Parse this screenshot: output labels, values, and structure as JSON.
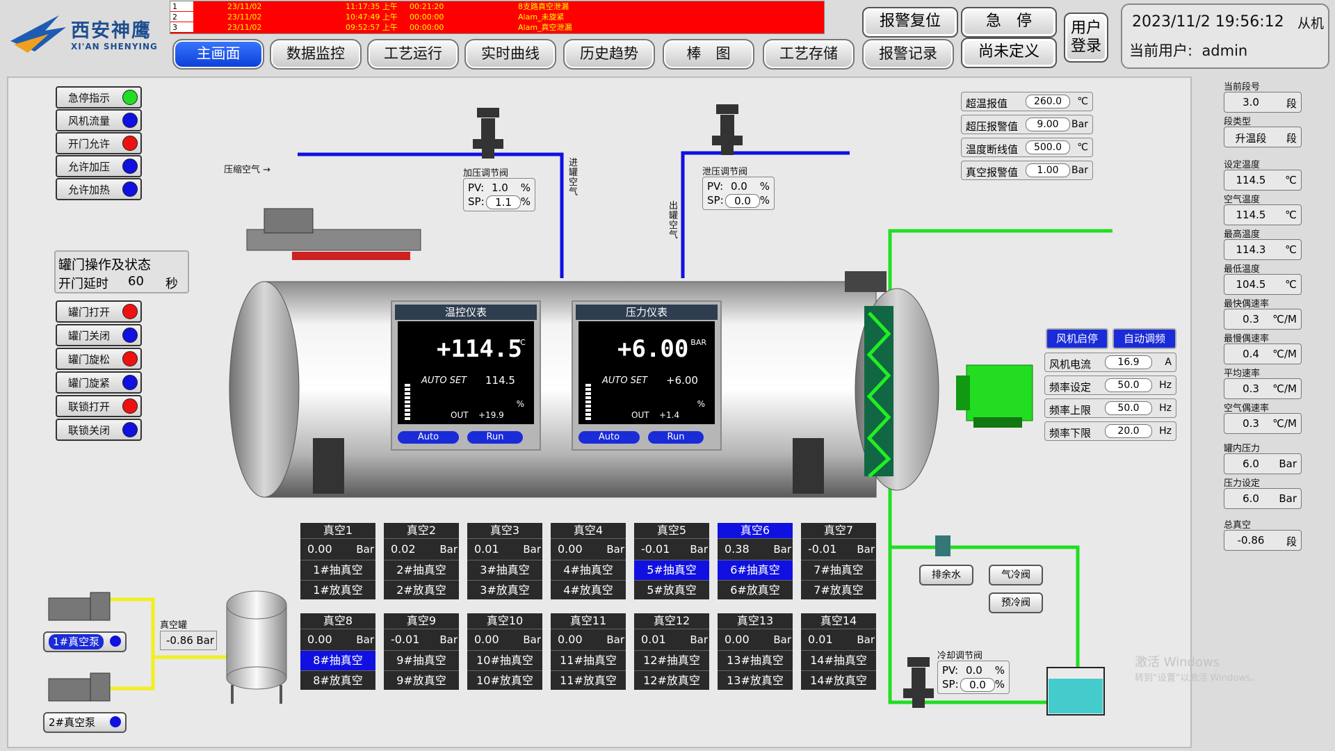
{
  "brand": {
    "cn": "西安神鹰",
    "en": "XI'AN SHENYING"
  },
  "alarms": [
    {
      "idx": "1",
      "date": "23/11/02",
      "time": "11:17:35 上午",
      "dur": "00:21:20",
      "msg": "8支路真空泄漏"
    },
    {
      "idx": "2",
      "date": "23/11/02",
      "time": "10:47:49 上午",
      "dur": "00:00:00",
      "msg": "Alam_未旋紧"
    },
    {
      "idx": "3",
      "date": "23/11/02",
      "time": "09:52:57 上午",
      "dur": "00:00:00",
      "msg": "Alam_真空泄漏"
    }
  ],
  "nav": [
    "主画面",
    "数据监控",
    "工艺运行",
    "实时曲线",
    "历史趋势",
    "棒　图",
    "工艺存储",
    "报警记录"
  ],
  "side_buttons": {
    "alarm_reset": "报警复位",
    "estop": "急　停",
    "undefined": "尚未定义",
    "login": "用户\n登录"
  },
  "status": {
    "datetime": "2023/11/2 19:56:12",
    "user_label": "当前用户:",
    "user": "admin",
    "corner": "从机"
  },
  "indicators": [
    {
      "label": "急停指示",
      "color": "#22dd22"
    },
    {
      "label": "风机流量",
      "color": "#1010e0"
    },
    {
      "label": "开门允许",
      "color": "#ee1111"
    },
    {
      "label": "允许加压",
      "color": "#1010e0"
    },
    {
      "label": "允许加热",
      "color": "#1010e0"
    }
  ],
  "door": {
    "title": "罐门操作及状态",
    "delay_label": "开门延时",
    "delay_value": "60",
    "delay_unit": "秒",
    "ops": [
      {
        "label": "罐门打开",
        "color": "#ee1111"
      },
      {
        "label": "罐门关闭",
        "color": "#1010e0"
      },
      {
        "label": "罐门旋松",
        "color": "#ee1111"
      },
      {
        "label": "罐门旋紧",
        "color": "#1010e0"
      },
      {
        "label": "联锁打开",
        "color": "#ee1111"
      },
      {
        "label": "联锁关闭",
        "color": "#1010e0"
      }
    ]
  },
  "labels": {
    "compressed_air": "压缩空气 →",
    "tank_in": "进罐空气",
    "tank_out": "出罐空气",
    "vac_tank": "真空罐"
  },
  "valves": {
    "pressurize": {
      "title": "加压调节阀",
      "pv_label": "PV:",
      "pv": "1.0",
      "sp_label": "SP:",
      "sp": "1.1",
      "unit": "%"
    },
    "release": {
      "title": "泄压调节阀",
      "pv_label": "PV:",
      "pv": "0.0",
      "sp_label": "SP:",
      "sp": "0.0",
      "unit": "%"
    },
    "cooling": {
      "title": "冷却调节阀",
      "pv_label": "PV:",
      "pv": "0.0",
      "sp_label": "SP:",
      "sp": "0.0",
      "unit": "%"
    }
  },
  "limits": [
    {
      "label": "超温报值",
      "value": "260.0",
      "unit": "℃"
    },
    {
      "label": "超压报警值",
      "value": "9.00",
      "unit": "Bar"
    },
    {
      "label": "温度断线值",
      "value": "500.0",
      "unit": "℃"
    },
    {
      "label": "真空报警值",
      "value": "1.00",
      "unit": "Bar"
    }
  ],
  "temp_meter": {
    "title": "温控仪表",
    "value": "+114.5",
    "unit": "℃",
    "autoset_label": "AUTO SET",
    "autoset": "114.5",
    "out_label": "OUT",
    "out": "+19.9",
    "pct": "%",
    "auto": "Auto",
    "run": "Run"
  },
  "press_meter": {
    "title": "压力仪表",
    "value": "+6.00",
    "unit": "BAR",
    "autoset_label": "AUTO SET",
    "autoset": "+6.00",
    "out_label": "OUT",
    "out": "+1.4",
    "pct": "%",
    "auto": "Auto",
    "run": "Run"
  },
  "fan": {
    "start": "风机启停",
    "auto": "自动调频",
    "rows": [
      {
        "label": "风机电流",
        "value": "16.9",
        "unit": "A"
      },
      {
        "label": "频率设定",
        "value": "50.0",
        "unit": "Hz"
      },
      {
        "label": "频率上限",
        "value": "50.0",
        "unit": "Hz"
      },
      {
        "label": "频率下限",
        "value": "20.0",
        "unit": "Hz"
      }
    ]
  },
  "right": [
    {
      "label": "当前段号",
      "value": "3.0",
      "unit": "段"
    },
    {
      "label": "段类型",
      "value": "升温段",
      "unit": "段"
    },
    {
      "label": "设定温度",
      "value": "114.5",
      "unit": "℃"
    },
    {
      "label": "空气温度",
      "value": "114.5",
      "unit": "℃"
    },
    {
      "label": "最高温度",
      "value": "114.3",
      "unit": "℃"
    },
    {
      "label": "最低温度",
      "value": "104.5",
      "unit": "℃"
    },
    {
      "label": "最快偶速率",
      "value": "0.3",
      "unit": "℃/M"
    },
    {
      "label": "最慢偶速率",
      "value": "0.4",
      "unit": "℃/M"
    },
    {
      "label": "平均速率",
      "value": "0.3",
      "unit": "℃/M"
    },
    {
      "label": "空气偶速率",
      "value": "0.3",
      "unit": "℃/M"
    },
    {
      "label": "罐内压力",
      "value": "6.0",
      "unit": "Bar"
    },
    {
      "label": "压力设定",
      "value": "6.0",
      "unit": "Bar"
    },
    {
      "label": "总真空",
      "value": "-0.86",
      "unit": "段"
    }
  ],
  "vacuum": [
    {
      "name": "真空1",
      "value": "0.00",
      "pump": "1#抽真空",
      "rel": "1#放真空",
      "hl": false,
      "pl": false
    },
    {
      "name": "真空2",
      "value": "0.02",
      "pump": "2#抽真空",
      "rel": "2#放真空",
      "hl": false,
      "pl": false
    },
    {
      "name": "真空3",
      "value": "0.01",
      "pump": "3#抽真空",
      "rel": "3#放真空",
      "hl": false,
      "pl": false
    },
    {
      "name": "真空4",
      "value": "0.00",
      "pump": "4#抽真空",
      "rel": "4#放真空",
      "hl": false,
      "pl": false
    },
    {
      "name": "真空5",
      "value": "-0.01",
      "pump": "5#抽真空",
      "rel": "5#放真空",
      "hl": false,
      "pl": true
    },
    {
      "name": "真空6",
      "value": "0.38",
      "pump": "6#抽真空",
      "rel": "6#放真空",
      "hl": true,
      "pl": true
    },
    {
      "name": "真空7",
      "value": "-0.01",
      "pump": "7#抽真空",
      "rel": "7#放真空",
      "hl": false,
      "pl": false
    },
    {
      "name": "真空8",
      "value": "0.00",
      "pump": "8#抽真空",
      "rel": "8#放真空",
      "hl": false,
      "pl": true
    },
    {
      "name": "真空9",
      "value": "-0.01",
      "pump": "9#抽真空",
      "rel": "9#放真空",
      "hl": false,
      "pl": false
    },
    {
      "name": "真空10",
      "value": "0.00",
      "pump": "10#抽真空",
      "rel": "10#放真空",
      "hl": false,
      "pl": false
    },
    {
      "name": "真空11",
      "value": "0.00",
      "pump": "11#抽真空",
      "rel": "11#放真空",
      "hl": false,
      "pl": false
    },
    {
      "name": "真空12",
      "value": "0.01",
      "pump": "12#抽真空",
      "rel": "12#放真空",
      "hl": false,
      "pl": false
    },
    {
      "name": "真空13",
      "value": "0.00",
      "pump": "13#抽真空",
      "rel": "13#放真空",
      "hl": false,
      "pl": false
    },
    {
      "name": "真空14",
      "value": "0.01",
      "pump": "14#抽真空",
      "rel": "14#放真空",
      "hl": false,
      "pl": false
    }
  ],
  "vac_unit": "Bar",
  "pumps": [
    {
      "label": "1#真空泵"
    },
    {
      "label": "2#真空泵"
    }
  ],
  "vac_tank_value": "-0.86",
  "vac_tank_unit": "Bar",
  "cool_buttons": {
    "drain": "排余水",
    "air_cool": "气冷阀",
    "pre_cool": "预冷阀"
  },
  "watermark": {
    "line1": "激活 Windows",
    "line2": "转到“设置”以激活 Windows。"
  }
}
